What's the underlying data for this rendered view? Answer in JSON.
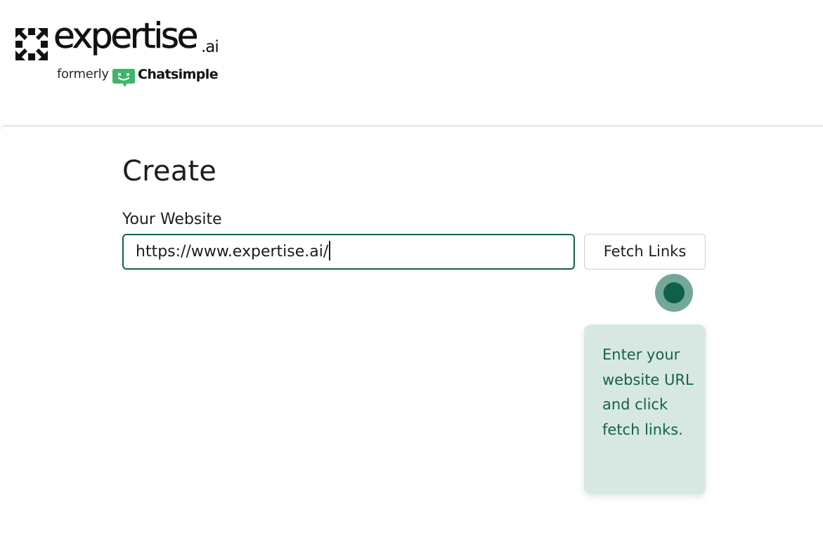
{
  "brand": {
    "name": "expertise",
    "suffix": ".ai",
    "formerly_label": "formerly",
    "former_name": "Chatsimple",
    "colors": {
      "logo": "#111111",
      "chatsimple_green": "#3fb56a"
    }
  },
  "page": {
    "title": "Create"
  },
  "form": {
    "website_label": "Your Website",
    "website_value": "https://www.expertise.ai/",
    "fetch_button_label": "Fetch Links"
  },
  "walkthrough": {
    "tooltip_text": "Enter your website URL and click fetch links.",
    "colors": {
      "beacon_outer": "#73a898",
      "beacon_inner": "#0f5f4a",
      "tooltip_bg": "#d7e8e2",
      "tooltip_text": "#14614c"
    }
  },
  "colors": {
    "accent": "#13614c",
    "background": "#ffffff",
    "border": "#cfcfcf"
  },
  "icons": [
    "expertise-logo-icon",
    "chatsimple-logo-icon"
  ]
}
